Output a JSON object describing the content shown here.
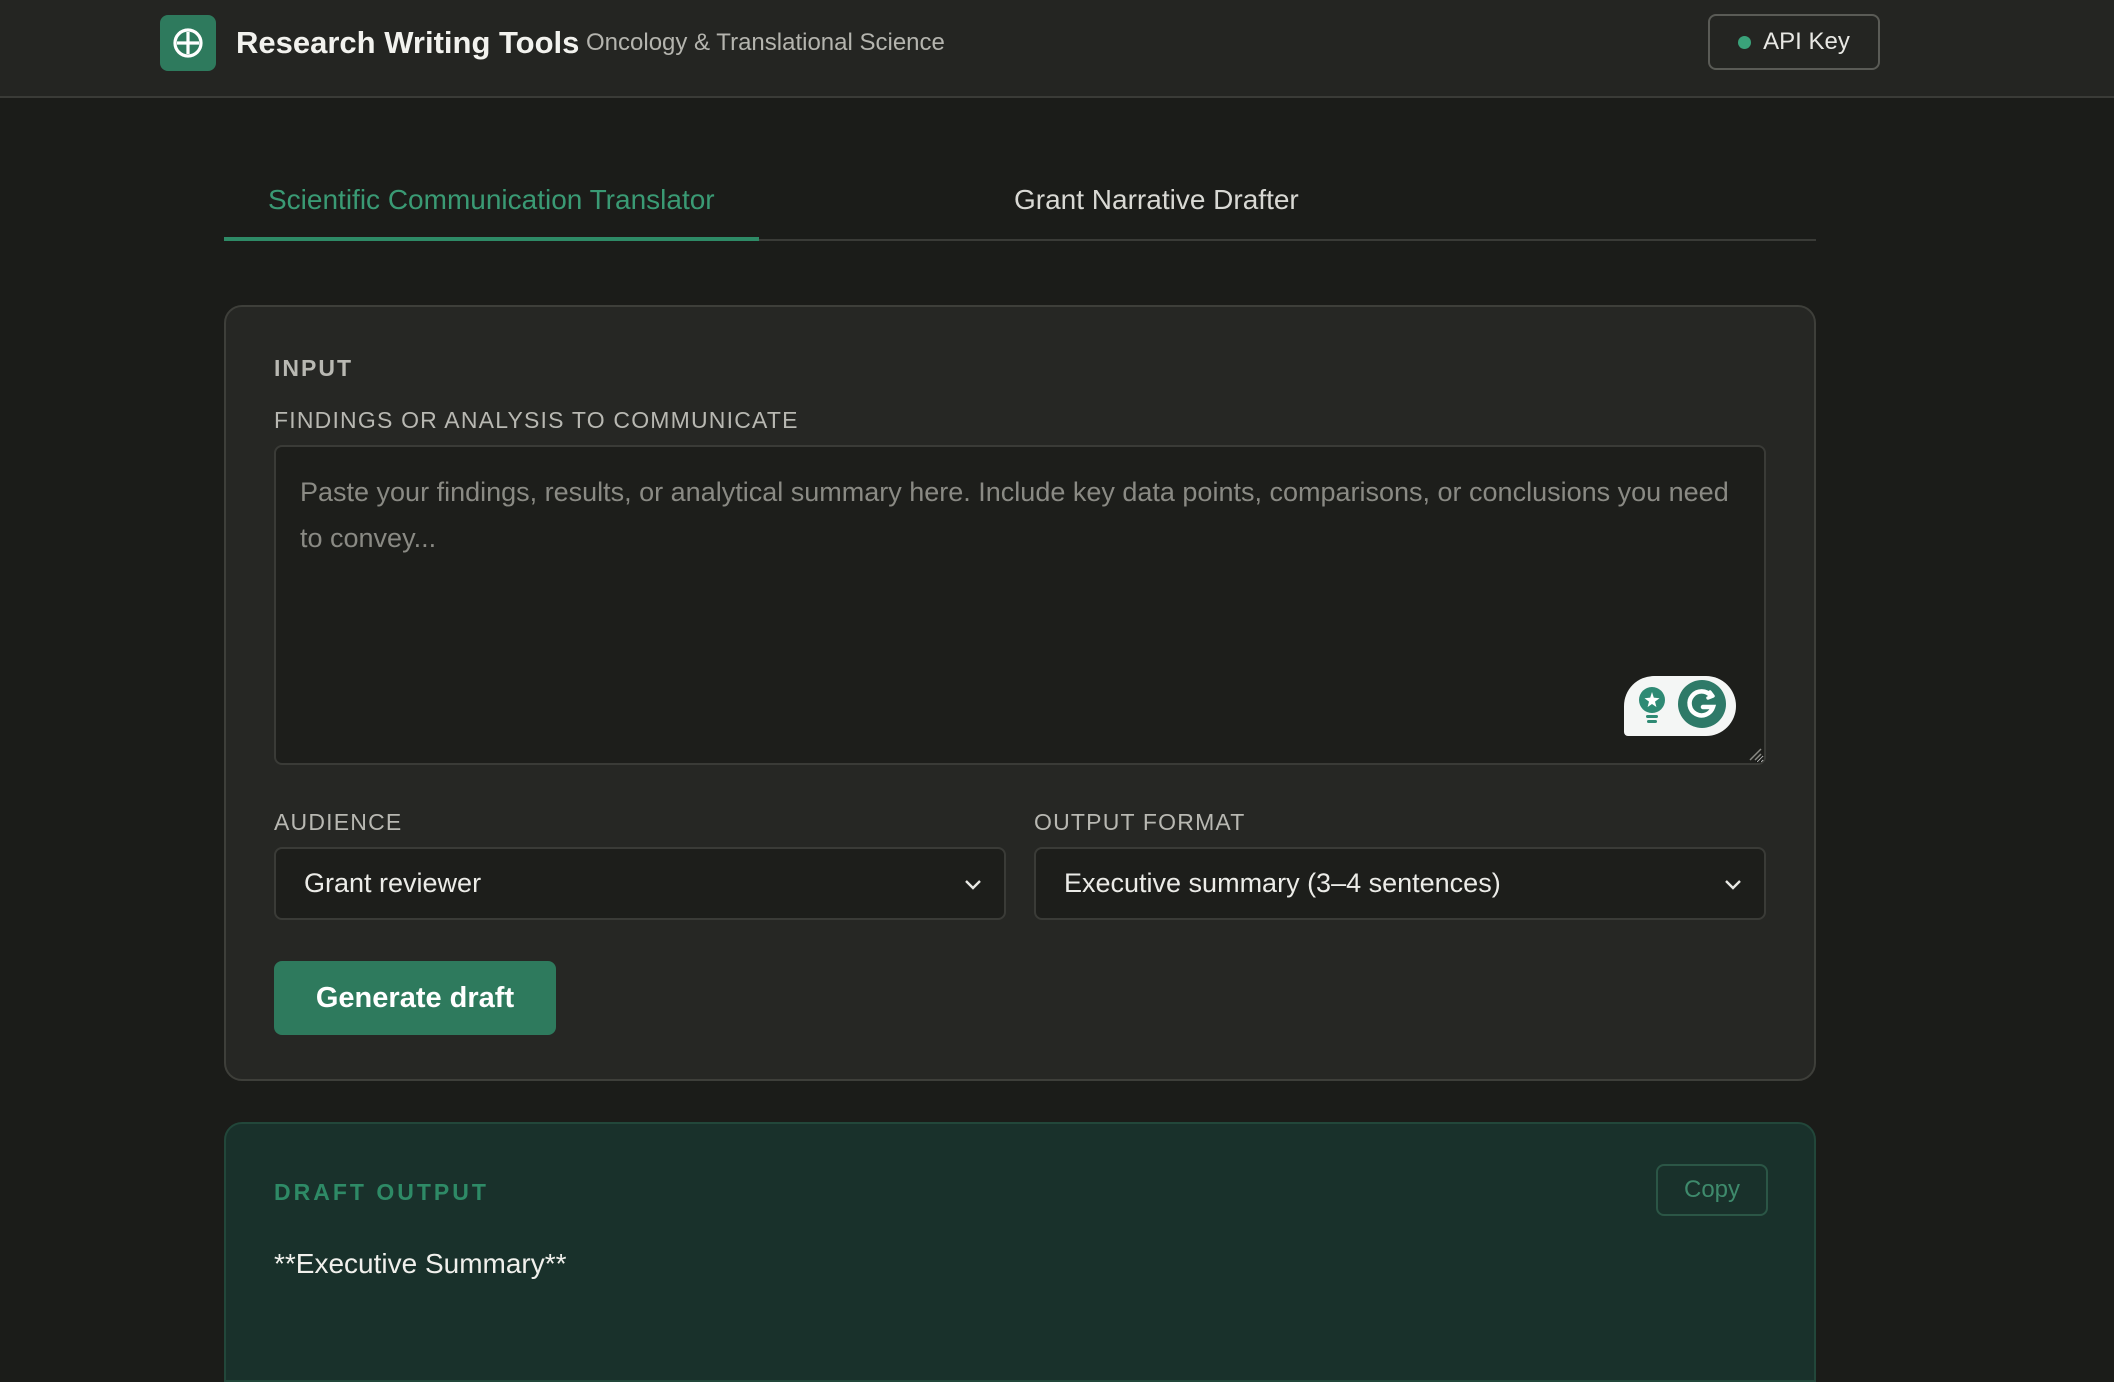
{
  "header": {
    "title": "Research Writing Tools",
    "subtitle": "Oncology & Translational Science",
    "api_key_label": "API Key",
    "api_status_color": "#3aa27a",
    "logo_icon": "plus-circle-icon"
  },
  "tabs": [
    {
      "label": "Scientific Communication Translator",
      "active": true
    },
    {
      "label": "Grant Narrative Drafter",
      "active": false
    }
  ],
  "input_card": {
    "section_label": "INPUT",
    "findings_label": "FINDINGS OR ANALYSIS TO COMMUNICATE",
    "findings_placeholder": "Paste your findings, results, or analytical summary here. Include key data points, comparisons, or conclusions you need to convey...",
    "findings_value": "",
    "audience_label": "AUDIENCE",
    "audience_value": "Grant reviewer",
    "format_label": "OUTPUT FORMAT",
    "format_value": "Executive summary (3–4 sentences)",
    "generate_label": "Generate draft"
  },
  "output_card": {
    "section_label": "DRAFT OUTPUT",
    "copy_label": "Copy",
    "text": "**Executive Summary**"
  },
  "colors": {
    "accent": "#2e7a5d",
    "accent_text": "#3a9a74",
    "background": "#1b1c19",
    "output_bg": "#19312b"
  }
}
